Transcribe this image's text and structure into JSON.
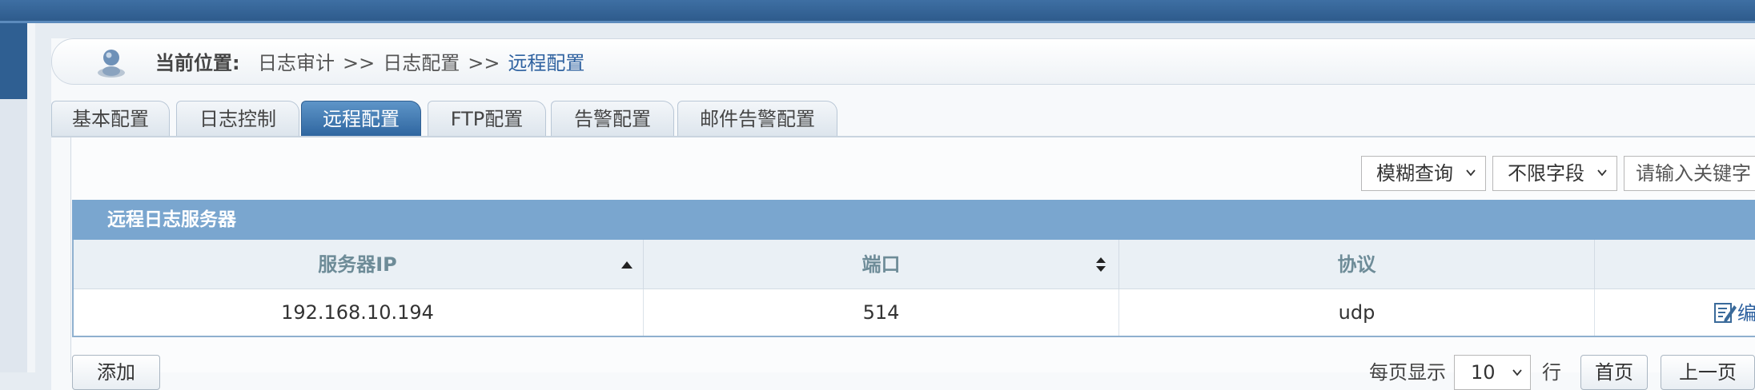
{
  "breadcrumb": {
    "label": "当前位置:",
    "items": [
      "日志审计",
      "日志配置",
      "远程配置"
    ],
    "separator": ">>"
  },
  "tabs": [
    {
      "label": "基本配置",
      "active": false
    },
    {
      "label": "日志控制",
      "active": false
    },
    {
      "label": "远程配置",
      "active": true
    },
    {
      "label": "FTP配置",
      "active": false
    },
    {
      "label": "告警配置",
      "active": false
    },
    {
      "label": "邮件告警配置",
      "active": false
    }
  ],
  "filters": {
    "match_mode": "模糊查询",
    "field": "不限字段",
    "keyword_placeholder": "请输入关键字"
  },
  "table": {
    "title": "远程日志服务器",
    "columns": [
      "服务器IP",
      "端口",
      "协议",
      ""
    ],
    "rows": [
      {
        "ip": "192.168.10.194",
        "port": "514",
        "protocol": "udp",
        "action": "编"
      }
    ]
  },
  "footer": {
    "add_label": "添加",
    "per_page_label": "每页显示",
    "per_page_value": "10",
    "rows_unit": "行",
    "first_label": "首页",
    "prev_label": "上一页"
  },
  "colors": {
    "accent": "#2f66a0",
    "table_header": "#7aa6cf",
    "link": "#2f62a0"
  }
}
